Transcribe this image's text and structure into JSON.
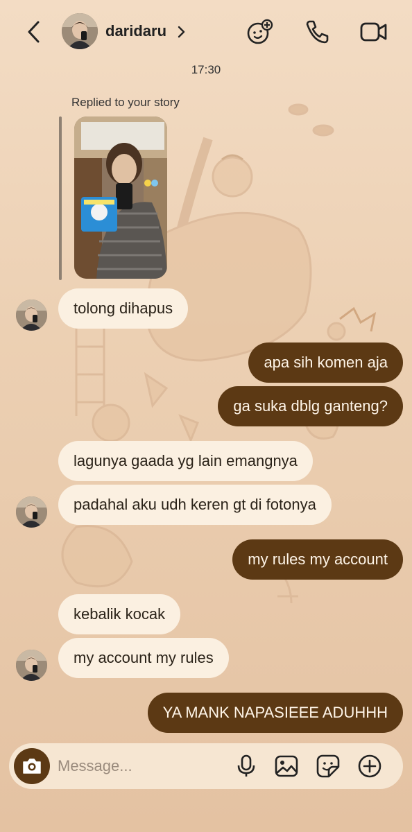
{
  "header": {
    "contact_name": "daridaru",
    "icons": [
      "back-icon",
      "chevron-right-icon",
      "effects-icon",
      "phone-icon",
      "video-icon"
    ]
  },
  "timestamp": "17:30",
  "story_reply": {
    "label": "Replied to your story"
  },
  "messages": [
    {
      "direction": "in",
      "text": "tolong dihapus"
    },
    {
      "direction": "out",
      "text": "apa sih komen aja"
    },
    {
      "direction": "out",
      "text": "ga suka dblg ganteng?"
    },
    {
      "direction": "in",
      "text": "lagunya gaada yg lain emangnya"
    },
    {
      "direction": "in",
      "text": "padahal aku udh keren gt di fotonya"
    },
    {
      "direction": "out",
      "text": "my rules my account"
    },
    {
      "direction": "in",
      "text": "kebalik kocak"
    },
    {
      "direction": "in",
      "text": "my account my rules"
    },
    {
      "direction": "out",
      "text": "YA MANK NAPASIEEE ADUHHH"
    }
  ],
  "composer": {
    "placeholder": "Message...",
    "icons": [
      "camera-icon",
      "microphone-icon",
      "image-icon",
      "sticker-icon",
      "plus-icon"
    ]
  },
  "colors": {
    "background": "#f0d6bb",
    "incoming_bubble": "#fbf0e1",
    "outgoing_bubble": "#5c3914",
    "accent": "#5c3914"
  }
}
